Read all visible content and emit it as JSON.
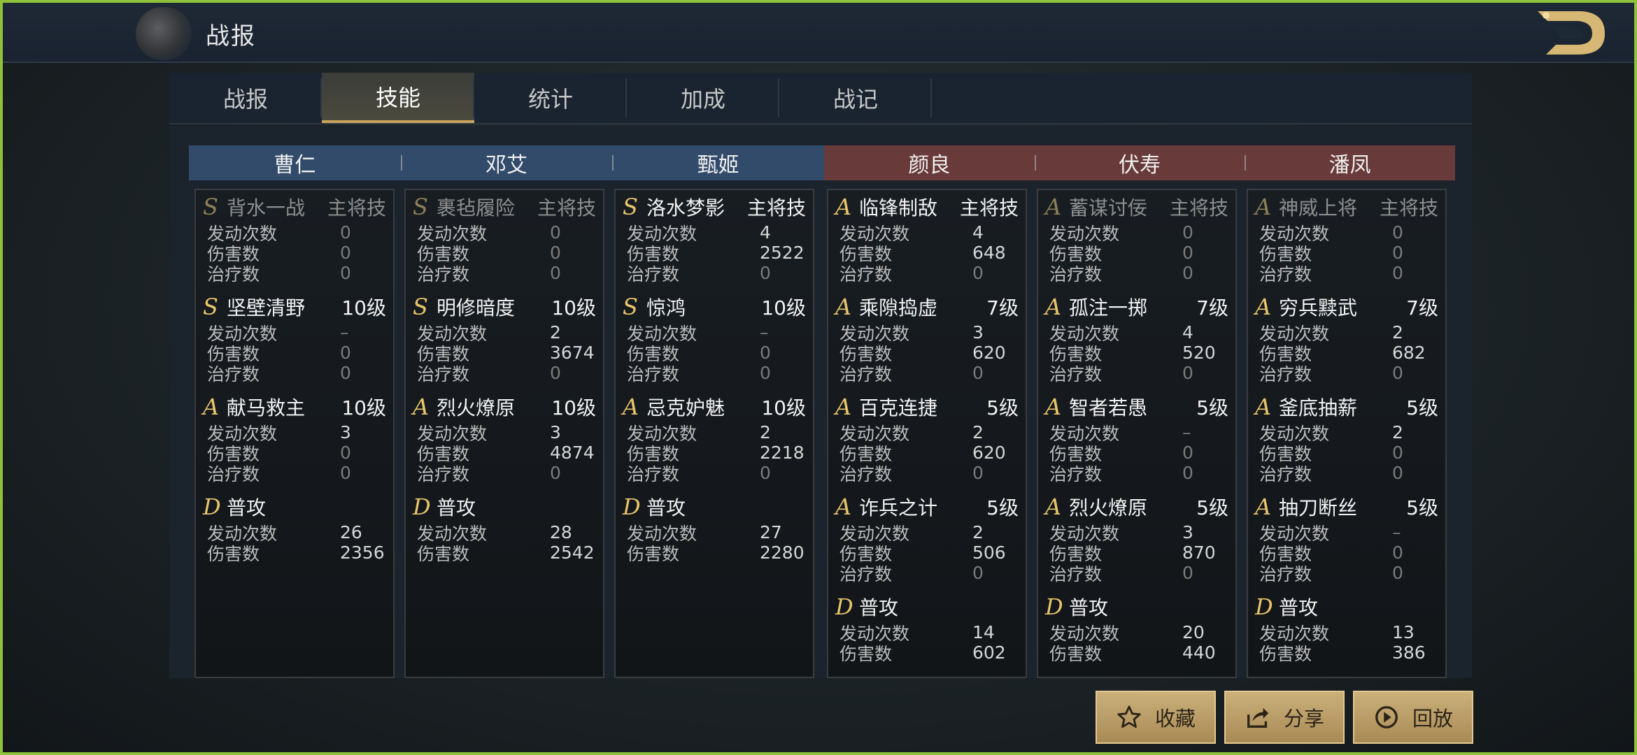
{
  "header": {
    "title": "战报",
    "logo": "dragon-logo-icon"
  },
  "tabs": [
    {
      "label": "战报",
      "active": false
    },
    {
      "label": "技能",
      "active": true
    },
    {
      "label": "统计",
      "active": false
    },
    {
      "label": "加成",
      "active": false
    },
    {
      "label": "战记",
      "active": false
    }
  ],
  "teams": {
    "left_color": "#334b6b",
    "right_color": "#693a3a",
    "grade_color": "#e8c56a"
  },
  "heroes": [
    {
      "name": "曹仁",
      "skills": [
        {
          "grade": "S",
          "name": "背水一战",
          "level": "主将技",
          "dim": true,
          "stats": [
            [
              "发动次数",
              "0"
            ],
            [
              "伤害数",
              "0"
            ],
            [
              "治疗数",
              "0"
            ]
          ]
        },
        {
          "grade": "S",
          "name": "坚壁清野",
          "level": "10级",
          "dim": false,
          "stats": [
            [
              "发动次数",
              "–"
            ],
            [
              "伤害数",
              "0"
            ],
            [
              "治疗数",
              "0"
            ]
          ]
        },
        {
          "grade": "A",
          "name": "献马救主",
          "level": "10级",
          "dim": false,
          "stats": [
            [
              "发动次数",
              "3"
            ],
            [
              "伤害数",
              "0"
            ],
            [
              "治疗数",
              "0"
            ]
          ]
        },
        {
          "grade": "D",
          "name": "普攻",
          "level": "",
          "dim": false,
          "stats": [
            [
              "发动次数",
              "26"
            ],
            [
              "伤害数",
              "2356"
            ]
          ]
        }
      ]
    },
    {
      "name": "邓艾",
      "skills": [
        {
          "grade": "S",
          "name": "裹毡履险",
          "level": "主将技",
          "dim": true,
          "stats": [
            [
              "发动次数",
              "0"
            ],
            [
              "伤害数",
              "0"
            ],
            [
              "治疗数",
              "0"
            ]
          ]
        },
        {
          "grade": "S",
          "name": "明修暗度",
          "level": "10级",
          "dim": false,
          "stats": [
            [
              "发动次数",
              "2"
            ],
            [
              "伤害数",
              "3674"
            ],
            [
              "治疗数",
              "0"
            ]
          ]
        },
        {
          "grade": "A",
          "name": "烈火燎原",
          "level": "10级",
          "dim": false,
          "stats": [
            [
              "发动次数",
              "3"
            ],
            [
              "伤害数",
              "4874"
            ],
            [
              "治疗数",
              "0"
            ]
          ]
        },
        {
          "grade": "D",
          "name": "普攻",
          "level": "",
          "dim": false,
          "stats": [
            [
              "发动次数",
              "28"
            ],
            [
              "伤害数",
              "2542"
            ]
          ]
        }
      ]
    },
    {
      "name": "甄姬",
      "skills": [
        {
          "grade": "S",
          "name": "洛水梦影",
          "level": "主将技",
          "dim": false,
          "stats": [
            [
              "发动次数",
              "4"
            ],
            [
              "伤害数",
              "2522"
            ],
            [
              "治疗数",
              "0"
            ]
          ]
        },
        {
          "grade": "S",
          "name": "惊鸿",
          "level": "10级",
          "dim": false,
          "stats": [
            [
              "发动次数",
              "–"
            ],
            [
              "伤害数",
              "0"
            ],
            [
              "治疗数",
              "0"
            ]
          ]
        },
        {
          "grade": "A",
          "name": "忌克妒魅",
          "level": "10级",
          "dim": false,
          "stats": [
            [
              "发动次数",
              "2"
            ],
            [
              "伤害数",
              "2218"
            ],
            [
              "治疗数",
              "0"
            ]
          ]
        },
        {
          "grade": "D",
          "name": "普攻",
          "level": "",
          "dim": false,
          "stats": [
            [
              "发动次数",
              "27"
            ],
            [
              "伤害数",
              "2280"
            ]
          ]
        }
      ]
    },
    {
      "name": "颜良",
      "skills": [
        {
          "grade": "A",
          "name": "临锋制敌",
          "level": "主将技",
          "dim": false,
          "stats": [
            [
              "发动次数",
              "4"
            ],
            [
              "伤害数",
              "648"
            ],
            [
              "治疗数",
              "0"
            ]
          ]
        },
        {
          "grade": "A",
          "name": "乘隙捣虚",
          "level": "7级",
          "dim": false,
          "stats": [
            [
              "发动次数",
              "3"
            ],
            [
              "伤害数",
              "620"
            ],
            [
              "治疗数",
              "0"
            ]
          ]
        },
        {
          "grade": "A",
          "name": "百克连捷",
          "level": "5级",
          "dim": false,
          "stats": [
            [
              "发动次数",
              "2"
            ],
            [
              "伤害数",
              "620"
            ],
            [
              "治疗数",
              "0"
            ]
          ]
        },
        {
          "grade": "A",
          "name": "诈兵之计",
          "level": "5级",
          "dim": false,
          "stats": [
            [
              "发动次数",
              "2"
            ],
            [
              "伤害数",
              "506"
            ],
            [
              "治疗数",
              "0"
            ]
          ]
        },
        {
          "grade": "D",
          "name": "普攻",
          "level": "",
          "dim": false,
          "stats": [
            [
              "发动次数",
              "14"
            ],
            [
              "伤害数",
              "602"
            ]
          ]
        }
      ]
    },
    {
      "name": "伏寿",
      "skills": [
        {
          "grade": "A",
          "name": "蓄谋讨佞",
          "level": "主将技",
          "dim": true,
          "stats": [
            [
              "发动次数",
              "0"
            ],
            [
              "伤害数",
              "0"
            ],
            [
              "治疗数",
              "0"
            ]
          ]
        },
        {
          "grade": "A",
          "name": "孤注一掷",
          "level": "7级",
          "dim": false,
          "stats": [
            [
              "发动次数",
              "4"
            ],
            [
              "伤害数",
              "520"
            ],
            [
              "治疗数",
              "0"
            ]
          ]
        },
        {
          "grade": "A",
          "name": "智者若愚",
          "level": "5级",
          "dim": false,
          "stats": [
            [
              "发动次数",
              "–"
            ],
            [
              "伤害数",
              "0"
            ],
            [
              "治疗数",
              "0"
            ]
          ]
        },
        {
          "grade": "A",
          "name": "烈火燎原",
          "level": "5级",
          "dim": false,
          "stats": [
            [
              "发动次数",
              "3"
            ],
            [
              "伤害数",
              "870"
            ],
            [
              "治疗数",
              "0"
            ]
          ]
        },
        {
          "grade": "D",
          "name": "普攻",
          "level": "",
          "dim": false,
          "stats": [
            [
              "发动次数",
              "20"
            ],
            [
              "伤害数",
              "440"
            ]
          ]
        }
      ]
    },
    {
      "name": "潘凤",
      "skills": [
        {
          "grade": "A",
          "name": "神威上将",
          "level": "主将技",
          "dim": true,
          "stats": [
            [
              "发动次数",
              "0"
            ],
            [
              "伤害数",
              "0"
            ],
            [
              "治疗数",
              "0"
            ]
          ]
        },
        {
          "grade": "A",
          "name": "穷兵黩武",
          "level": "7级",
          "dim": false,
          "stats": [
            [
              "发动次数",
              "2"
            ],
            [
              "伤害数",
              "682"
            ],
            [
              "治疗数",
              "0"
            ]
          ]
        },
        {
          "grade": "A",
          "name": "釜底抽薪",
          "level": "5级",
          "dim": false,
          "stats": [
            [
              "发动次数",
              "2"
            ],
            [
              "伤害数",
              "0"
            ],
            [
              "治疗数",
              "0"
            ]
          ]
        },
        {
          "grade": "A",
          "name": "抽刀断丝",
          "level": "5级",
          "dim": false,
          "stats": [
            [
              "发动次数",
              "–"
            ],
            [
              "伤害数",
              "0"
            ],
            [
              "治疗数",
              "0"
            ]
          ]
        },
        {
          "grade": "D",
          "name": "普攻",
          "level": "",
          "dim": false,
          "stats": [
            [
              "发动次数",
              "13"
            ],
            [
              "伤害数",
              "386"
            ]
          ]
        }
      ]
    }
  ],
  "buttons": {
    "favorite": {
      "label": "收藏",
      "icon": "star-icon"
    },
    "share": {
      "label": "分享",
      "icon": "share-icon"
    },
    "replay": {
      "label": "回放",
      "icon": "play-icon"
    }
  }
}
